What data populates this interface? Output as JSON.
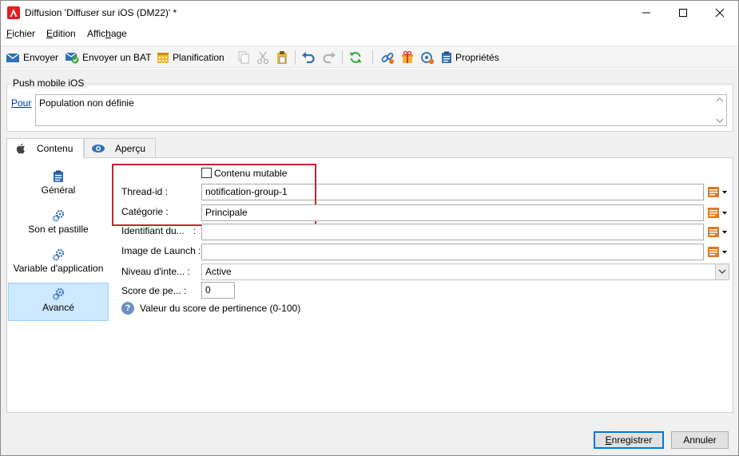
{
  "window": {
    "title": "Diffusion 'Diffuser sur iOS (DM22)' *",
    "icons": [
      "app-logo-icon",
      "minimize-icon",
      "maximize-icon",
      "close-icon"
    ]
  },
  "menu": {
    "items": [
      {
        "label": "Fichier",
        "mnemonic": "F"
      },
      {
        "label": "Edition",
        "mnemonic": "E"
      },
      {
        "label": "Affichage",
        "mnemonic": "h"
      }
    ]
  },
  "toolbar": {
    "send_label": "Envoyer",
    "send_proof_label": "Envoyer un BAT",
    "schedule_label": "Planification",
    "properties_label": "Propriétés",
    "icons": [
      "envelope-icon",
      "envelope-check-icon",
      "calendar-icon",
      "copy-icon",
      "cut-icon",
      "paste-icon",
      "undo-icon",
      "redo-icon",
      "refresh-icon",
      "link-icon",
      "gift-icon",
      "target-icon",
      "clipboard-icon"
    ]
  },
  "target_group": {
    "title": "Push mobile iOS",
    "link_label": "Pour",
    "population_text": "Population non définie"
  },
  "tabs": [
    {
      "label": "Contenu",
      "icon": "apple-icon",
      "active": true
    },
    {
      "label": "Aperçu",
      "icon": "eye-icon",
      "active": false
    }
  ],
  "sidebar": {
    "items": [
      {
        "label": "Général",
        "icon": "clipboard-icon"
      },
      {
        "label": "Son et pastille",
        "icon": "gears-icon"
      },
      {
        "label": "Variable d'application",
        "icon": "gears-icon"
      },
      {
        "label": "Avancé",
        "icon": "gears-icon",
        "active": true
      }
    ]
  },
  "form": {
    "mutable_content_label": "Contenu mutable",
    "mutable_content_checked": false,
    "thread_id_label": "Thread-id :",
    "thread_id_value": "notification-group-1",
    "category_label": "Catégorie :",
    "category_value": "Principale",
    "identifier_label": "Identifiant du...",
    "identifier_colon": ":",
    "identifier_value": "",
    "launch_image_label": "Image de Launch :",
    "launch_image_value": "",
    "interruption_label": "Niveau d'inte... :",
    "interruption_value": "Active",
    "relevance_label": "Score de pe... :",
    "relevance_value": "0",
    "relevance_help": "Valeur du score de pertinence (0-100)"
  },
  "footer": {
    "save_label": "Enregistrer",
    "save_mnemonic": "E",
    "cancel_label": "Annuler"
  },
  "colors": {
    "highlight_box": "#c0262d",
    "active_sidebar": "#cde8ff",
    "link": "#0033cc",
    "app_logo": "#e31b23"
  }
}
